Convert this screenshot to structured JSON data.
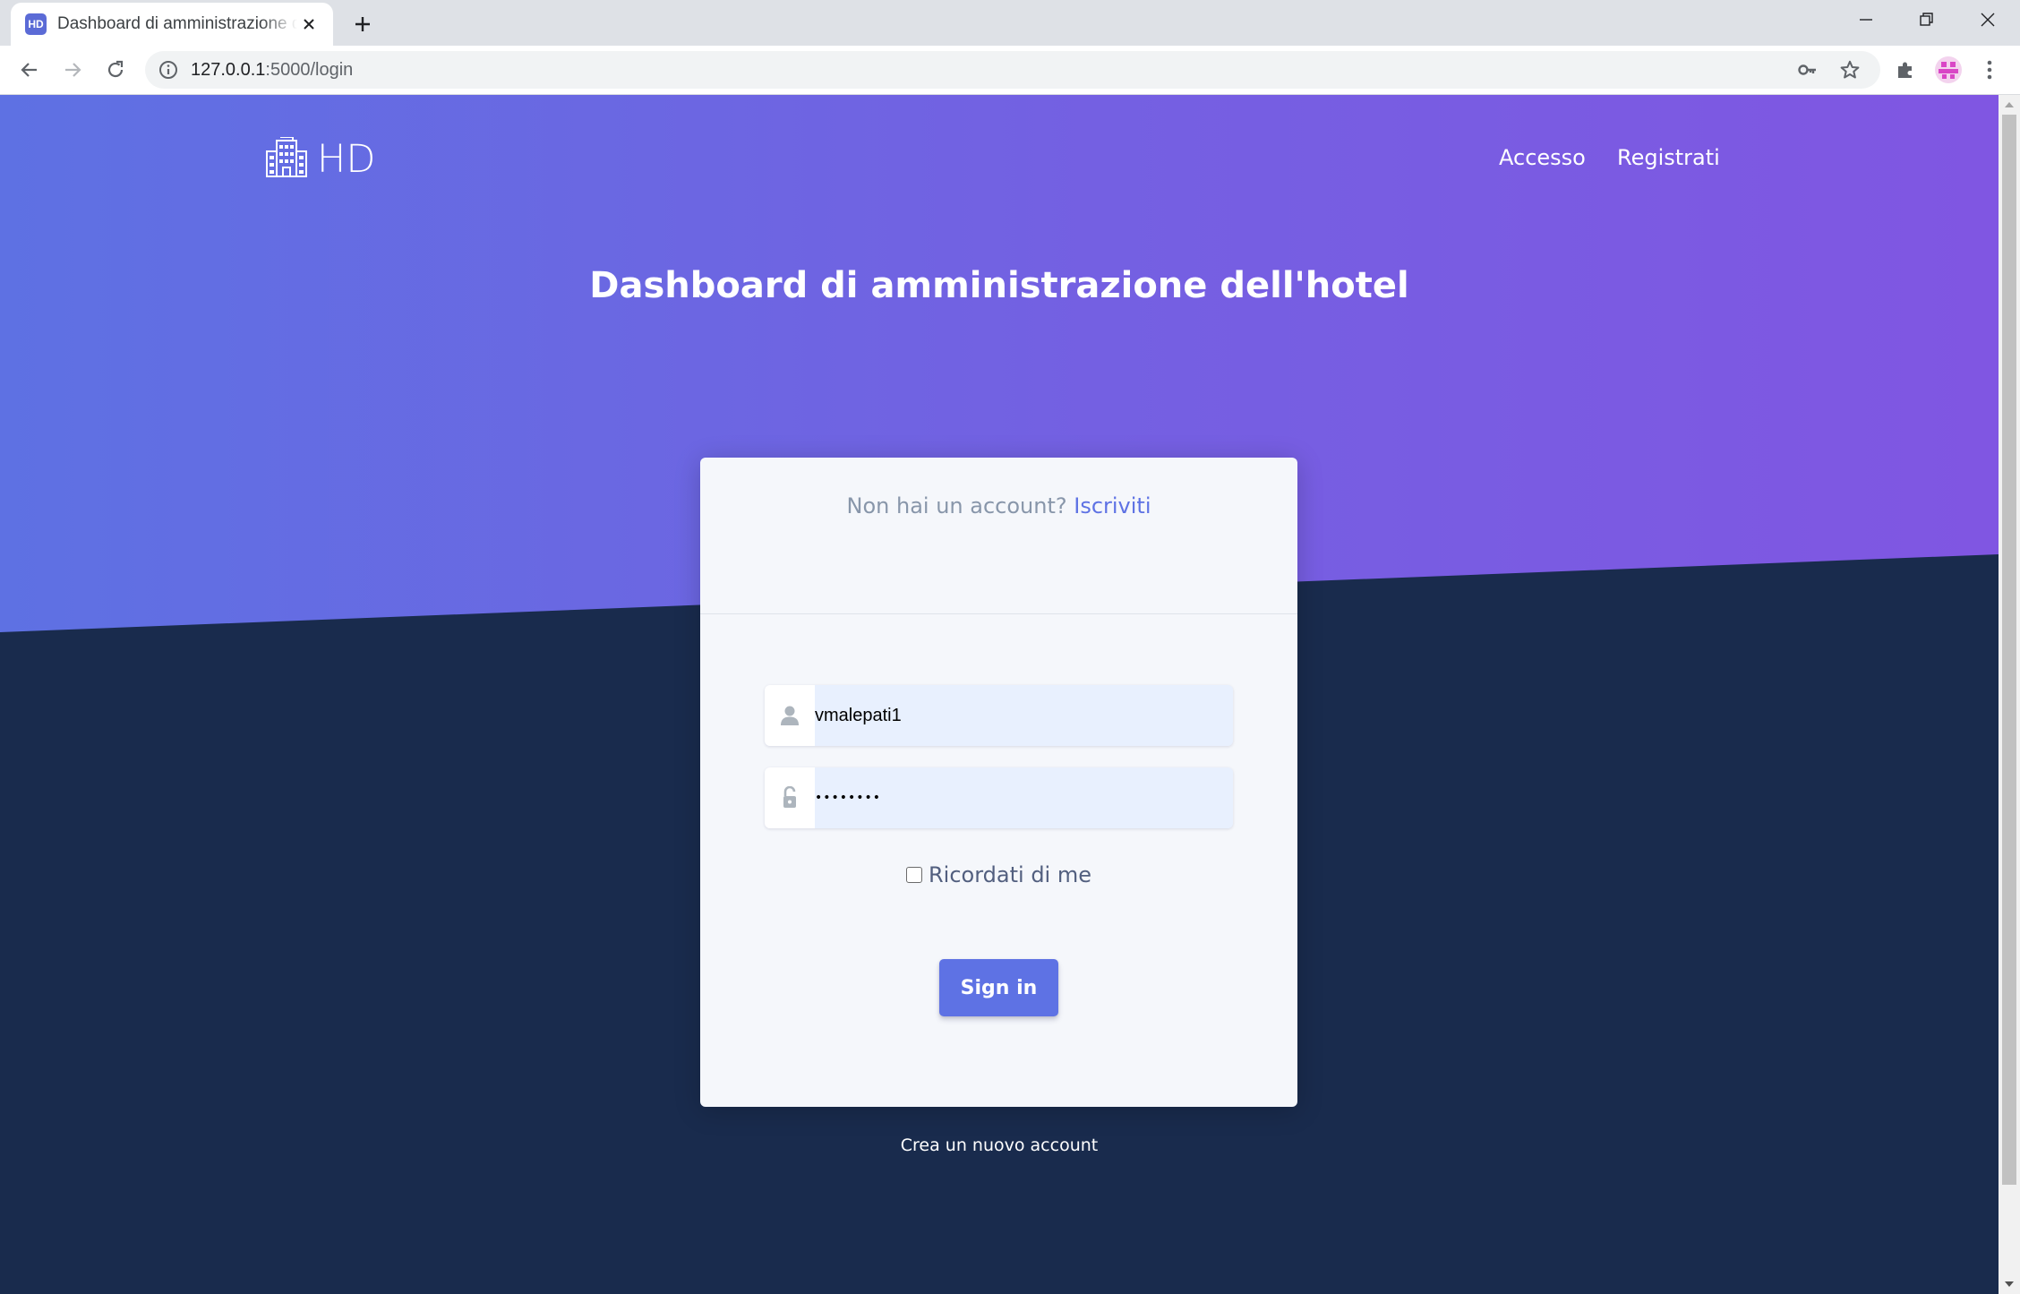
{
  "browser": {
    "tab": {
      "favicon_text": "HD",
      "title": "Dashboard di amministrazione dell'hotel"
    },
    "url": {
      "host": "127.0.0.1",
      "path": ":5000/login"
    },
    "icons": {
      "close_tab": "close-icon",
      "new_tab": "plus-icon",
      "back": "arrow-left-icon",
      "forward": "arrow-right-icon",
      "reload": "reload-icon",
      "site_info": "info-icon",
      "passwords": "key-icon",
      "bookmark": "star-icon",
      "extensions": "puzzle-icon",
      "profile": "avatar-icon",
      "menu": "kebab-menu-icon"
    }
  },
  "page": {
    "brand": {
      "logo_icon": "building-icon",
      "text": "HD"
    },
    "nav": {
      "login": "Accesso",
      "register": "Registrati"
    },
    "title": "Dashboard di amministrazione dell'hotel",
    "card": {
      "signup_prompt": "Non hai un account?",
      "signup_link": "Iscriviti",
      "username": {
        "icon": "user-icon",
        "value": "vmalepati1"
      },
      "password": {
        "icon": "lock-open-icon",
        "value": "••••••••"
      },
      "remember_label": "Ricordati di me",
      "remember_checked": false,
      "submit_label": "Sign in"
    },
    "footer_link": "Crea un nuovo account"
  },
  "colors": {
    "hero_start": "#5e71e3",
    "hero_end": "#8056e2",
    "background_dark": "#192b4d",
    "card_bg": "#f5f7fb",
    "primary": "#5e72e4",
    "input_autofill": "#e8f0fe"
  }
}
